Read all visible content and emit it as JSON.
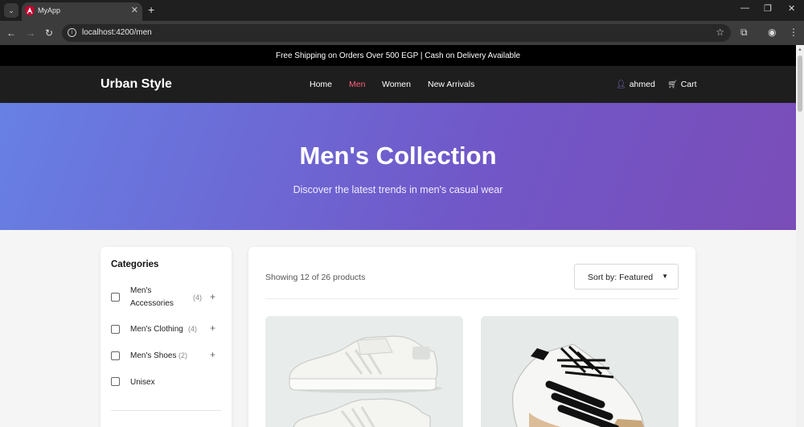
{
  "browser": {
    "tab_title": "MyApp",
    "tab_close": "✕",
    "new_tab": "+",
    "url": "localhost:4200/men",
    "menu_icon": "chevron-down-icon"
  },
  "announcement": "Free Shipping on Orders Over 500 EGP | Cash on Delivery Available",
  "header": {
    "brand": "Urban Style",
    "nav": [
      "Home",
      "Men",
      "Women",
      "New Arrivals"
    ],
    "active_nav": "Men",
    "user": "ahmed",
    "cart": "Cart"
  },
  "hero": {
    "title": "Men's Collection",
    "subtitle": "Discover the latest trends in men's casual wear"
  },
  "sidebar": {
    "title": "Categories",
    "categories": [
      {
        "label_line1": "Men's",
        "label_line2": "Accessories",
        "count": "(4)",
        "expand": "+"
      },
      {
        "label": "Men's Clothing",
        "count": "(4)",
        "expand": "+"
      },
      {
        "label": "Men's Shoes",
        "count": "(2)",
        "expand": "+"
      },
      {
        "label": "Unisex"
      }
    ]
  },
  "products": {
    "showing": "Showing 12 of 26 products",
    "sort_label": "Sort by: Featured"
  },
  "colors": {
    "accent": "#ff5c7a",
    "hero_start": "#6780e4",
    "hero_end": "#7a4db8",
    "header_bg": "#1e1e1e"
  }
}
